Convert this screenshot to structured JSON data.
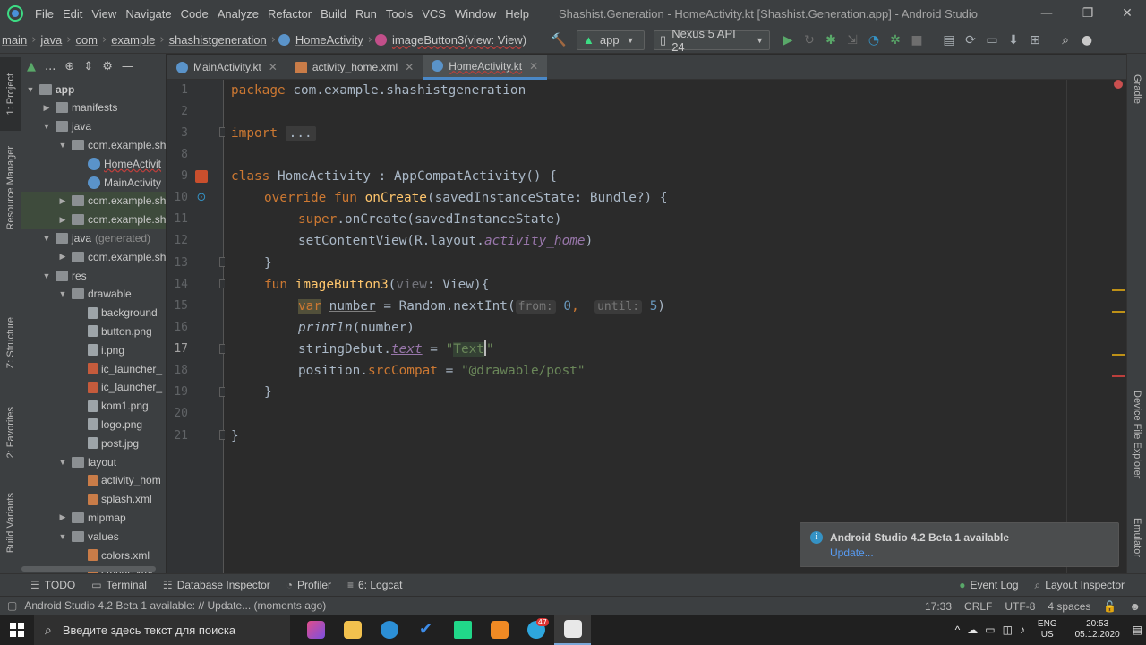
{
  "window": {
    "title": "Shashist.Generation - HomeActivity.kt [Shashist.Generation.app] - Android Studio",
    "menu": [
      "File",
      "Edit",
      "View",
      "Navigate",
      "Code",
      "Analyze",
      "Refactor",
      "Build",
      "Run",
      "Tools",
      "VCS",
      "Window",
      "Help"
    ],
    "controls": {
      "minimize": "—",
      "maximize": "❐",
      "close": "✕"
    }
  },
  "breadcrumbs": [
    "main",
    "java",
    "com",
    "example",
    "shashistgeneration",
    "HomeActivity",
    "imageButton3(view: View)"
  ],
  "toolbar": {
    "run_config": "app",
    "device": "Nexus 5 API 24"
  },
  "left_tabs": [
    "1: Project",
    "Resource Manager",
    "Z: Structure",
    "2: Favorites",
    "Build Variants"
  ],
  "right_tabs": [
    "Gradle",
    "Device File Explorer",
    "Emulator"
  ],
  "project_header": {
    "view": "..."
  },
  "project_tree": [
    {
      "label": "app",
      "indent": 0,
      "twisty": "▼",
      "icon": "folder",
      "bold": true
    },
    {
      "label": "manifests",
      "indent": 1,
      "twisty": "▶",
      "icon": "folder"
    },
    {
      "label": "java",
      "indent": 1,
      "twisty": "▼",
      "icon": "folder"
    },
    {
      "label": "com.example.sh",
      "indent": 2,
      "twisty": "▼",
      "icon": "folder"
    },
    {
      "label": "HomeActivit",
      "indent": 3,
      "twisty": "",
      "icon": "kt",
      "error": true
    },
    {
      "label": "MainActivity",
      "indent": 3,
      "twisty": "",
      "icon": "kt"
    },
    {
      "label": "com.example.sh",
      "indent": 2,
      "twisty": "▶",
      "icon": "folder",
      "highlight": true
    },
    {
      "label": "com.example.sh",
      "indent": 2,
      "twisty": "▶",
      "icon": "folder",
      "highlight": true
    },
    {
      "label": "java",
      "suffix": "(generated)",
      "indent": 1,
      "twisty": "▼",
      "icon": "folder"
    },
    {
      "label": "com.example.sh",
      "indent": 2,
      "twisty": "▶",
      "icon": "folder"
    },
    {
      "label": "res",
      "indent": 1,
      "twisty": "▼",
      "icon": "folder"
    },
    {
      "label": "drawable",
      "indent": 2,
      "twisty": "▼",
      "icon": "folder"
    },
    {
      "label": "background",
      "indent": 3,
      "twisty": "",
      "icon": "img"
    },
    {
      "label": "button.png",
      "indent": 3,
      "twisty": "",
      "icon": "img"
    },
    {
      "label": "i.png",
      "indent": 3,
      "twisty": "",
      "icon": "img"
    },
    {
      "label": "ic_launcher_",
      "indent": 3,
      "twisty": "",
      "icon": "lic"
    },
    {
      "label": "ic_launcher_",
      "indent": 3,
      "twisty": "",
      "icon": "lic"
    },
    {
      "label": "kom1.png",
      "indent": 3,
      "twisty": "",
      "icon": "img"
    },
    {
      "label": "logo.png",
      "indent": 3,
      "twisty": "",
      "icon": "img"
    },
    {
      "label": "post.jpg",
      "indent": 3,
      "twisty": "",
      "icon": "img"
    },
    {
      "label": "layout",
      "indent": 2,
      "twisty": "▼",
      "icon": "folder"
    },
    {
      "label": "activity_hom",
      "indent": 3,
      "twisty": "",
      "icon": "xml"
    },
    {
      "label": "splash.xml",
      "indent": 3,
      "twisty": "",
      "icon": "xml"
    },
    {
      "label": "mipmap",
      "indent": 2,
      "twisty": "▶",
      "icon": "folder"
    },
    {
      "label": "values",
      "indent": 2,
      "twisty": "▼",
      "icon": "folder"
    },
    {
      "label": "colors.xml",
      "indent": 3,
      "twisty": "",
      "icon": "xml"
    },
    {
      "label": "strings.xml",
      "indent": 3,
      "twisty": "",
      "icon": "xml"
    }
  ],
  "editor_tabs": [
    {
      "label": "MainActivity.kt",
      "icon": "kt",
      "active": false
    },
    {
      "label": "activity_home.xml",
      "icon": "xml",
      "active": false
    },
    {
      "label": "HomeActivity.kt",
      "icon": "kt",
      "active": true
    }
  ],
  "editor": {
    "current_line": 17,
    "line_numbers": [
      "1",
      "2",
      "3",
      "8",
      "9",
      "10",
      "11",
      "12",
      "13",
      "14",
      "15",
      "16",
      "17",
      "18",
      "19",
      "20",
      "21"
    ],
    "code": {
      "l1_kw": "package",
      "l1_rest": " com.example.shashistgeneration",
      "l3_kw": "import",
      "l3_fold": "...",
      "l9_kw": "class",
      "l9_rest": " HomeActivity : AppCompatActivity() {",
      "l10_kw": "override fun",
      "l10_fn": "onCreate",
      "l10_rest": "(savedInstanceState: Bundle?) {",
      "l11_kw": "super",
      "l11_rest": ".onCreate(savedInstanceState)",
      "l12_a": "setContentView(R.layout.",
      "l12_prop": "activity_home",
      "l12_b": ")",
      "l13": "}",
      "l14_kw": "fun",
      "l14_fn": "imageButton3",
      "l14_param": "view",
      "l14_rest": ": View){",
      "l15_kw": "var",
      "l15_var": "number",
      "l15_mid": " = Random.nextInt(",
      "l15_hint1": "from:",
      "l15_n1": "0",
      "l15_comma": ",",
      "l15_hint2": "until:",
      "l15_n2": "5",
      "l15_end": ")",
      "l16_fn": "println",
      "l16_rest": "(number)",
      "l17_a": "stringDebut.",
      "l17_prop": "text",
      "l17_eq": " = ",
      "l17_q1": "\"",
      "l17_str": "Text",
      "l17_q2": "\"",
      "l18_a": "position.",
      "l18_prop": "srcCompat",
      "l18_eq": " = ",
      "l18_str": "\"@drawable/post\"",
      "l19": "}",
      "l21": "}"
    }
  },
  "notification": {
    "title": "Android Studio 4.2 Beta 1 available",
    "action": "Update..."
  },
  "bottom_tools": [
    {
      "label": "TODO",
      "icon": "☰"
    },
    {
      "label": "Terminal",
      "icon": "▭"
    },
    {
      "label": "Database Inspector",
      "icon": "☷"
    },
    {
      "label": "Profiler",
      "icon": "◔"
    },
    {
      "label": "6: Logcat",
      "icon": "≡"
    }
  ],
  "bottom_tools_right": [
    {
      "label": "Event Log",
      "icon": "●"
    },
    {
      "label": "Layout Inspector",
      "icon": "⌕"
    }
  ],
  "status": {
    "message": "Android Studio 4.2 Beta 1 available: // Update... (moments ago)",
    "position": "17:33",
    "line_sep": "CRLF",
    "encoding": "UTF-8",
    "indent": "4 spaces"
  },
  "taskbar": {
    "search_placeholder": "Введите здесь текст для поиска",
    "lang_top": "ENG",
    "lang_bottom": "US",
    "time": "20:53",
    "date": "05.12.2020",
    "badge": "47"
  },
  "colors": {
    "keyword": "#cc7832",
    "function": "#ffc66d",
    "string": "#6a8759",
    "number": "#6897bb",
    "property": "#9876aa",
    "accent": "#4a88c7"
  }
}
